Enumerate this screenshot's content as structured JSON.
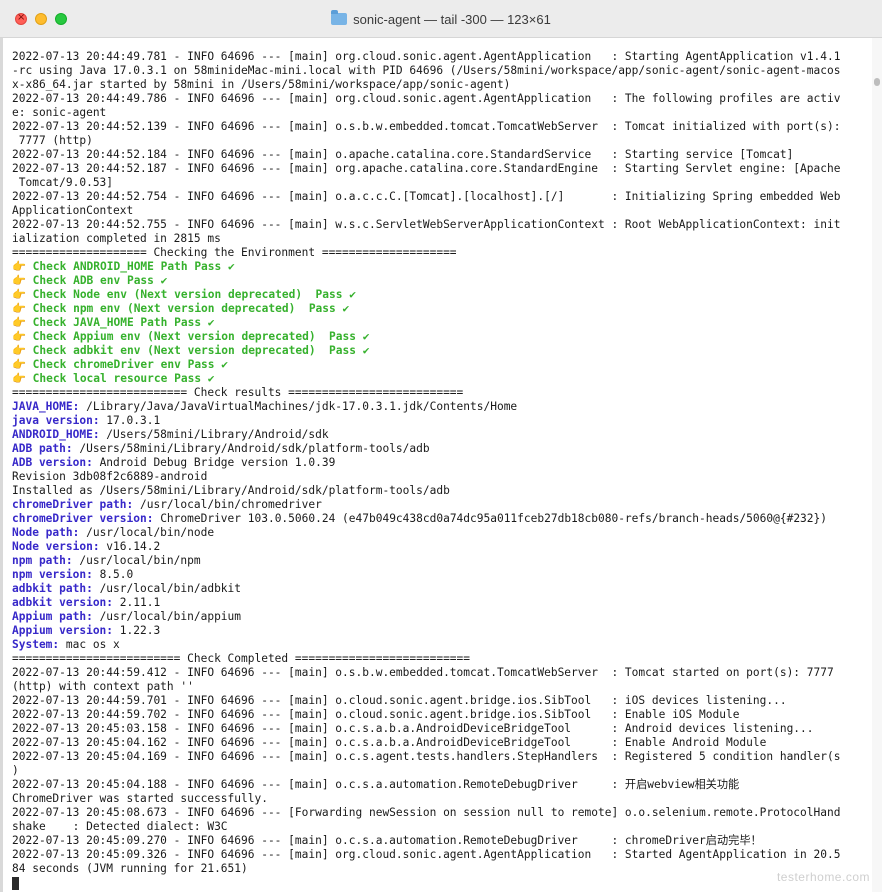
{
  "window": {
    "title": "sonic-agent — tail -300 — 123×61"
  },
  "log_lines": [
    {
      "text": "2022-07-13 20:44:49.781 - INFO 64696 --- [main] org.cloud.sonic.agent.AgentApplication   : Starting AgentApplication v1.4.1"
    },
    {
      "text": "-rc using Java 17.0.3.1 on 58minideMac-mini.local with PID 64696 (/Users/58mini/workspace/app/sonic-agent/sonic-agent-macos"
    },
    {
      "text": "x-x86_64.jar started by 58mini in /Users/58mini/workspace/app/sonic-agent)"
    },
    {
      "text": "2022-07-13 20:44:49.786 - INFO 64696 --- [main] org.cloud.sonic.agent.AgentApplication   : The following profiles are activ"
    },
    {
      "text": "e: sonic-agent"
    },
    {
      "text": "2022-07-13 20:44:52.139 - INFO 64696 --- [main] o.s.b.w.embedded.tomcat.TomcatWebServer  : Tomcat initialized with port(s):"
    },
    {
      "text": " 7777 (http)"
    },
    {
      "text": "2022-07-13 20:44:52.184 - INFO 64696 --- [main] o.apache.catalina.core.StandardService   : Starting service [Tomcat]"
    },
    {
      "text": "2022-07-13 20:44:52.187 - INFO 64696 --- [main] org.apache.catalina.core.StandardEngine  : Starting Servlet engine: [Apache"
    },
    {
      "text": " Tomcat/9.0.53]"
    },
    {
      "text": "2022-07-13 20:44:52.754 - INFO 64696 --- [main] o.a.c.c.C.[Tomcat].[localhost].[/]       : Initializing Spring embedded Web"
    },
    {
      "text": "ApplicationContext"
    },
    {
      "text": "2022-07-13 20:44:52.755 - INFO 64696 --- [main] w.s.c.ServletWebServerApplicationContext : Root WebApplicationContext: init"
    },
    {
      "text": "ialization completed in 2815 ms"
    },
    {
      "text": "==================== Checking the Environment ===================="
    },
    {
      "text": "👉 Check ANDROID_HOME Path Pass ✔",
      "style": "pass"
    },
    {
      "text": "👉 Check ADB env Pass ✔",
      "style": "pass"
    },
    {
      "text": "👉 Check Node env (Next version deprecated)  Pass ✔",
      "style": "pass"
    },
    {
      "text": "👉 Check npm env (Next version deprecated)  Pass ✔",
      "style": "pass"
    },
    {
      "text": "👉 Check JAVA_HOME Path Pass ✔",
      "style": "pass"
    },
    {
      "text": "👉 Check Appium env (Next version deprecated)  Pass ✔",
      "style": "pass"
    },
    {
      "text": "👉 Check adbkit env (Next version deprecated)  Pass ✔",
      "style": "pass"
    },
    {
      "text": "👉 Check chromeDriver env Pass ✔",
      "style": "pass"
    },
    {
      "text": "👉 Check local resource Pass ✔",
      "style": "pass"
    },
    {
      "text": "========================== Check results =========================="
    },
    {
      "key": "JAVA_HOME:",
      "text": " /Library/Java/JavaVirtualMachines/jdk-17.0.3.1.jdk/Contents/Home"
    },
    {
      "key": "java version:",
      "text": " 17.0.3.1"
    },
    {
      "key": "ANDROID_HOME:",
      "text": " /Users/58mini/Library/Android/sdk"
    },
    {
      "key": "ADB path:",
      "text": " /Users/58mini/Library/Android/sdk/platform-tools/adb"
    },
    {
      "key": "ADB version:",
      "text": " Android Debug Bridge version 1.0.39"
    },
    {
      "text": "Revision 3db08f2c6889-android"
    },
    {
      "text": "Installed as /Users/58mini/Library/Android/sdk/platform-tools/adb"
    },
    {
      "key": "chromeDriver path:",
      "text": " /usr/local/bin/chromedriver"
    },
    {
      "key": "chromeDriver version:",
      "text": " ChromeDriver 103.0.5060.24 (e47b049c438cd0a74dc95a011fceb27db18cb080-refs/branch-heads/5060@{#232})"
    },
    {
      "key": "Node path:",
      "text": " /usr/local/bin/node"
    },
    {
      "key": "Node version:",
      "text": " v16.14.2"
    },
    {
      "key": "npm path:",
      "text": " /usr/local/bin/npm"
    },
    {
      "key": "npm version:",
      "text": " 8.5.0"
    },
    {
      "key": "adbkit path:",
      "text": " /usr/local/bin/adbkit"
    },
    {
      "key": "adbkit version:",
      "text": " 2.11.1"
    },
    {
      "key": "Appium path:",
      "text": " /usr/local/bin/appium"
    },
    {
      "key": "Appium version:",
      "text": " 1.22.3"
    },
    {
      "key": "System:",
      "text": " mac os x"
    },
    {
      "text": "========================= Check Completed =========================="
    },
    {
      "text": "2022-07-13 20:44:59.412 - INFO 64696 --- [main] o.s.b.w.embedded.tomcat.TomcatWebServer  : Tomcat started on port(s): 7777"
    },
    {
      "text": "(http) with context path ''"
    },
    {
      "text": "2022-07-13 20:44:59.701 - INFO 64696 --- [main] o.cloud.sonic.agent.bridge.ios.SibTool   : iOS devices listening..."
    },
    {
      "text": "2022-07-13 20:44:59.702 - INFO 64696 --- [main] o.cloud.sonic.agent.bridge.ios.SibTool   : Enable iOS Module"
    },
    {
      "text": "2022-07-13 20:45:03.158 - INFO 64696 --- [main] o.c.s.a.b.a.AndroidDeviceBridgeTool      : Android devices listening..."
    },
    {
      "text": "2022-07-13 20:45:04.162 - INFO 64696 --- [main] o.c.s.a.b.a.AndroidDeviceBridgeTool      : Enable Android Module"
    },
    {
      "text": "2022-07-13 20:45:04.169 - INFO 64696 --- [main] o.c.s.agent.tests.handlers.StepHandlers  : Registered 5 condition handler(s"
    },
    {
      "text": ")"
    },
    {
      "text": "2022-07-13 20:45:04.188 - INFO 64696 --- [main] o.c.s.a.automation.RemoteDebugDriver     : 开启webview相关功能"
    },
    {
      "text": "ChromeDriver was started successfully."
    },
    {
      "text": "2022-07-13 20:45:08.673 - INFO 64696 --- [Forwarding newSession on session null to remote] o.o.selenium.remote.ProtocolHand"
    },
    {
      "text": "shake    : Detected dialect: W3C"
    },
    {
      "text": "2022-07-13 20:45:09.270 - INFO 64696 --- [main] o.c.s.a.automation.RemoteDebugDriver     : chromeDriver启动完毕！"
    },
    {
      "text": "2022-07-13 20:45:09.326 - INFO 64696 --- [main] org.cloud.sonic.agent.AgentApplication   : Started AgentApplication in 20.5"
    },
    {
      "text": "84 seconds (JVM running for 21.651)"
    }
  ],
  "watermark": "testerhome.com",
  "colors": {
    "pass": "#36b12d",
    "key": "#3728c9",
    "text": "#1a1a1a"
  },
  "icons": {
    "title_icon": "folder-icon"
  }
}
